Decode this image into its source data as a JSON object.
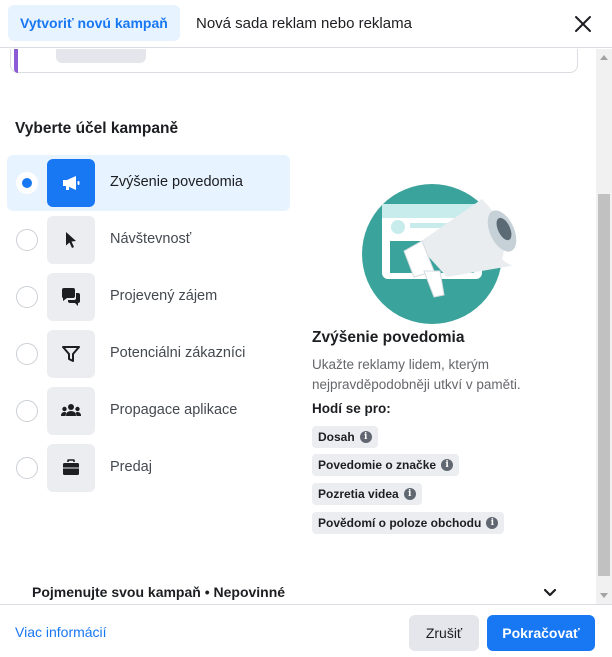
{
  "header": {
    "tab_active": "Vytvoriť novú kampaň",
    "tab_other": "Nová sada reklam nebo reklama",
    "close_icon": "close-icon"
  },
  "objectives": {
    "section_title": "Vyberte účel kampaně",
    "items": [
      {
        "label": "Zvýšenie povedomia",
        "icon": "megaphone-icon",
        "selected": true
      },
      {
        "label": "Návštevnosť",
        "icon": "cursor-icon",
        "selected": false
      },
      {
        "label": "Projevený zájem",
        "icon": "chat-bubbles-icon",
        "selected": false
      },
      {
        "label": "Potenciálni zákazníci",
        "icon": "funnel-icon",
        "selected": false
      },
      {
        "label": "Propagace aplikace",
        "icon": "people-icon",
        "selected": false
      },
      {
        "label": "Predaj",
        "icon": "briefcase-icon",
        "selected": false
      }
    ]
  },
  "detail": {
    "title": "Zvýšenie povedomia",
    "description": "Ukažte reklamy lidem, kterým nejpravděpodobněji utkví v paměti.",
    "good_for_label": "Hodí se pro:",
    "chips": [
      "Dosah",
      "Povedomie o značke",
      "Pozretia videa",
      "Povědomí o poloze obchodu"
    ]
  },
  "campaign_name": {
    "label": "Pojmenujte svou kampaň • Nepovinné"
  },
  "footer": {
    "more_info": "Viac informácií",
    "cancel": "Zrušiť",
    "continue": "Pokračovať"
  },
  "colors": {
    "accent": "#1877f2",
    "selected_bg": "#e7f3ff",
    "illustration_teal": "#3aa39b"
  }
}
